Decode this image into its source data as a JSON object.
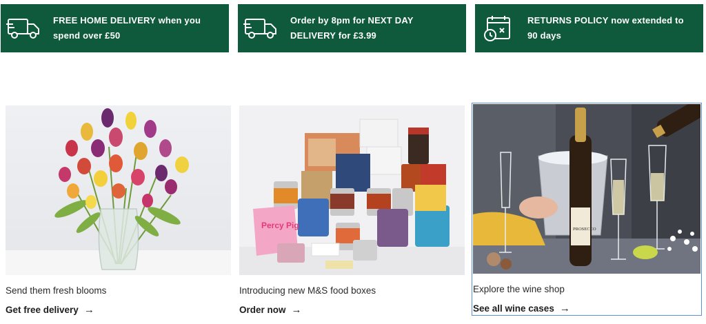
{
  "banners": [
    {
      "icon": "delivery-truck-icon",
      "text": "FREE HOME DELIVERY when you spend over £50"
    },
    {
      "icon": "delivery-truck-icon",
      "text": "Order by 8pm for NEXT DAY DELIVERY for £3.99"
    },
    {
      "icon": "calendar-return-icon",
      "text": "RETURNS POLICY now extended to 90 days"
    }
  ],
  "cards": [
    {
      "caption": "Send them fresh blooms",
      "cta": "Get free delivery",
      "arrow": "→"
    },
    {
      "caption": "Introducing new M&S food boxes",
      "cta": "Order now",
      "arrow": "→"
    },
    {
      "caption": "Explore the wine shop",
      "cta": "See all wine cases",
      "arrow": "→"
    }
  ],
  "images": {
    "food_labels": [
      "Percy Pig",
      "PROSECCO"
    ]
  },
  "colors": {
    "banner_bg": "#0f5a3c",
    "banner_text": "#ffffff",
    "selection_outline": "#5b8fd1"
  }
}
